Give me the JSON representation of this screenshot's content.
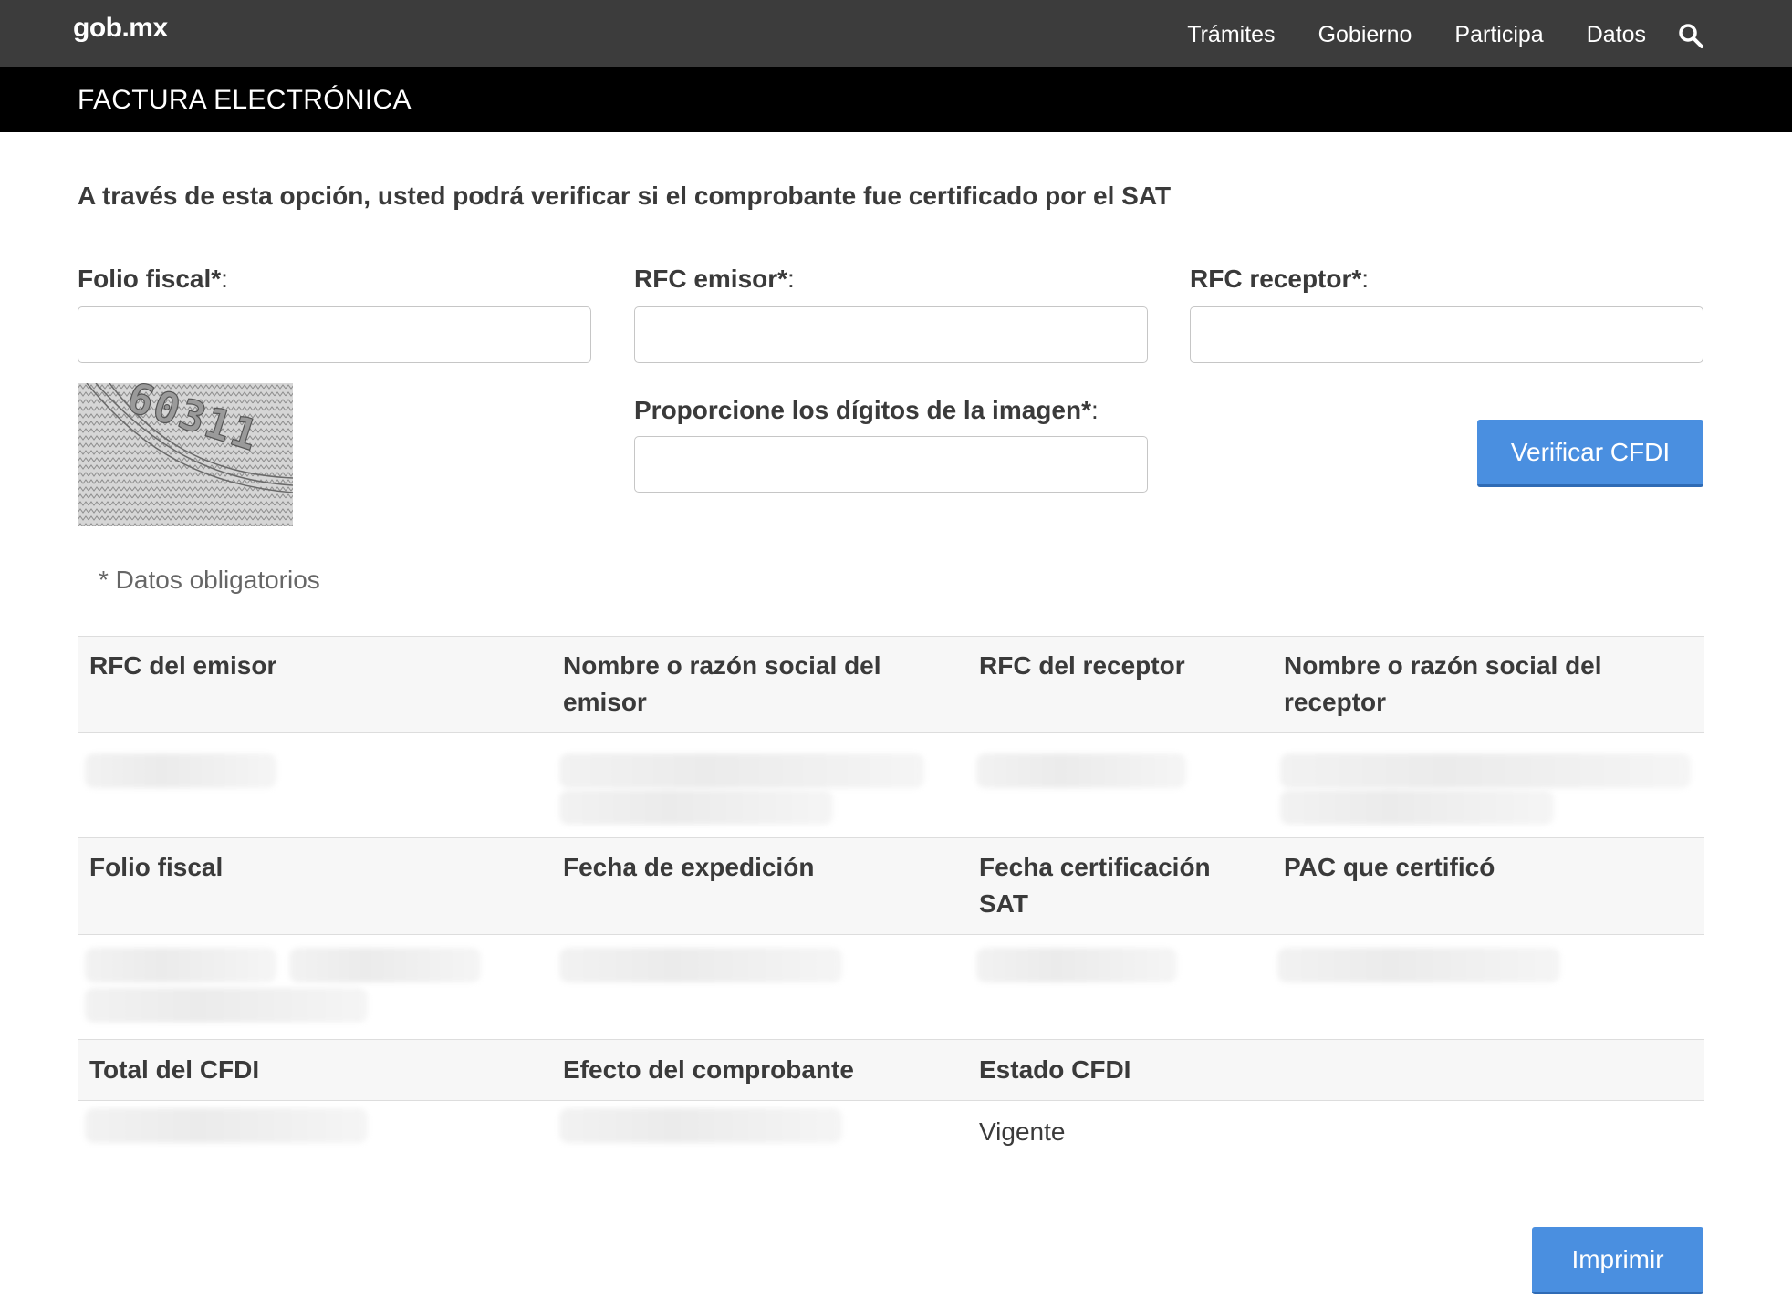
{
  "topnav": {
    "logo": "gob.mx",
    "links": [
      "Trámites",
      "Gobierno",
      "Participa",
      "Datos"
    ],
    "search_icon": "search-icon"
  },
  "titlebar": {
    "title": "FACTURA ELECTRÓNICA"
  },
  "intro": "A través de esta opción, usted podrá verificar si el comprobante fue certificado por el SAT",
  "form": {
    "folio_label": "Folio fiscal*",
    "rfc_emisor_label": "RFC emisor*",
    "rfc_receptor_label": "RFC receptor*",
    "captcha_label": "Proporcione los dígitos de la imagen*",
    "colon": ":",
    "folio_value": "",
    "rfc_emisor_value": "",
    "rfc_receptor_value": "",
    "captcha_value": "",
    "captcha_text": "60311",
    "verify_button": "Verificar CFDI",
    "required_note": "* Datos obligatorios"
  },
  "results": {
    "headers_1": [
      "RFC del emisor",
      "Nombre o razón social del emisor",
      "RFC del receptor",
      "Nombre o razón social del receptor"
    ],
    "headers_2": [
      "Folio fiscal",
      "Fecha de expedición",
      "Fecha certificación SAT",
      "PAC que certificó"
    ],
    "headers_3": [
      "Total del CFDI",
      "Efecto del comprobante",
      "Estado CFDI"
    ],
    "estado_value": "Vigente"
  },
  "print_button": "Imprimir",
  "colors": {
    "nav_bg": "#3c3c3c",
    "title_bg": "#000000",
    "button": "#4a8fe0"
  }
}
